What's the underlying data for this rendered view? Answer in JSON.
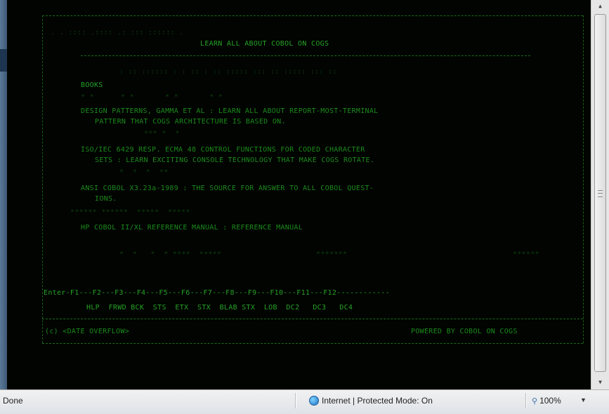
{
  "terminal": {
    "title": "LEARN ALL ABOUT COBOL ON COGS",
    "books_heading": "BOOKS",
    "book_1_line_1": "DESIGN PATTERNS, GAMMA ET AL : LEARN ALL ABOUT REPORT-MOST-TERMINAL",
    "book_1_line_2": "PATTERN THAT COGS ARCHITECTURE IS BASED ON.",
    "book_2_line_1": "ISO/IEC 6429 RESP. ECMA 48 CONTROL FUNCTIONS FOR CODED CHARACTER",
    "book_2_line_2": "SETS : LEARN EXCITING CONSOLE TECHNOLOGY THAT MAKE COGS ROTATE.",
    "book_3_line_1": "ANSI COBOL X3.23a-1989 : THE SOURCE FOR ANSWER TO ALL COBOL QUEST-",
    "book_3_line_2": "IONS.",
    "book_4": "HP COBOL II/XL REFERENCE MANUAL : REFERENCE MANUAL",
    "function_keys_row": "Enter-F1---F2---F3---F4---F5---F6---F7---F8---F9---F10---F11---F12------------",
    "function_labels_row": "HLP  FRWD BCK  STS  ETX  STX  BLAB STX  LOB  DC2   DC3   DC4",
    "footer_left": "(c) <DATE OVERFLOW>",
    "footer_right": "POWERED BY COBOL ON COGS",
    "noise_1": ". . :::: .:::: .: ::: :::::: .",
    "noise_2": ": :: :::::: : : :: : :: ::::: ::: :: ::::: ::: ::",
    "noise_3": "* *      * *       * *       * *",
    "noise_4": "*** *  *",
    "noise_5": "*  *  *  **",
    "noise_6": "****** ******  *****  *****",
    "noise_7": "*  *   *  * ****  *****",
    "noise_8": "*******",
    "noise_9": "******"
  },
  "browser": {
    "status_text": "Done",
    "zone_text": "Internet | Protected Mode: On",
    "zoom_text": "100%",
    "scroll_up": "▲",
    "scroll_down": "▼",
    "zoom_caret": "▼"
  },
  "colors": {
    "terminal_bg": "#010401",
    "terminal_text": "#1c8a1c",
    "frame": "#2f4f6b"
  },
  "icons": {
    "status_zone": "globe-icon",
    "zoom": "magnifier-icon"
  }
}
